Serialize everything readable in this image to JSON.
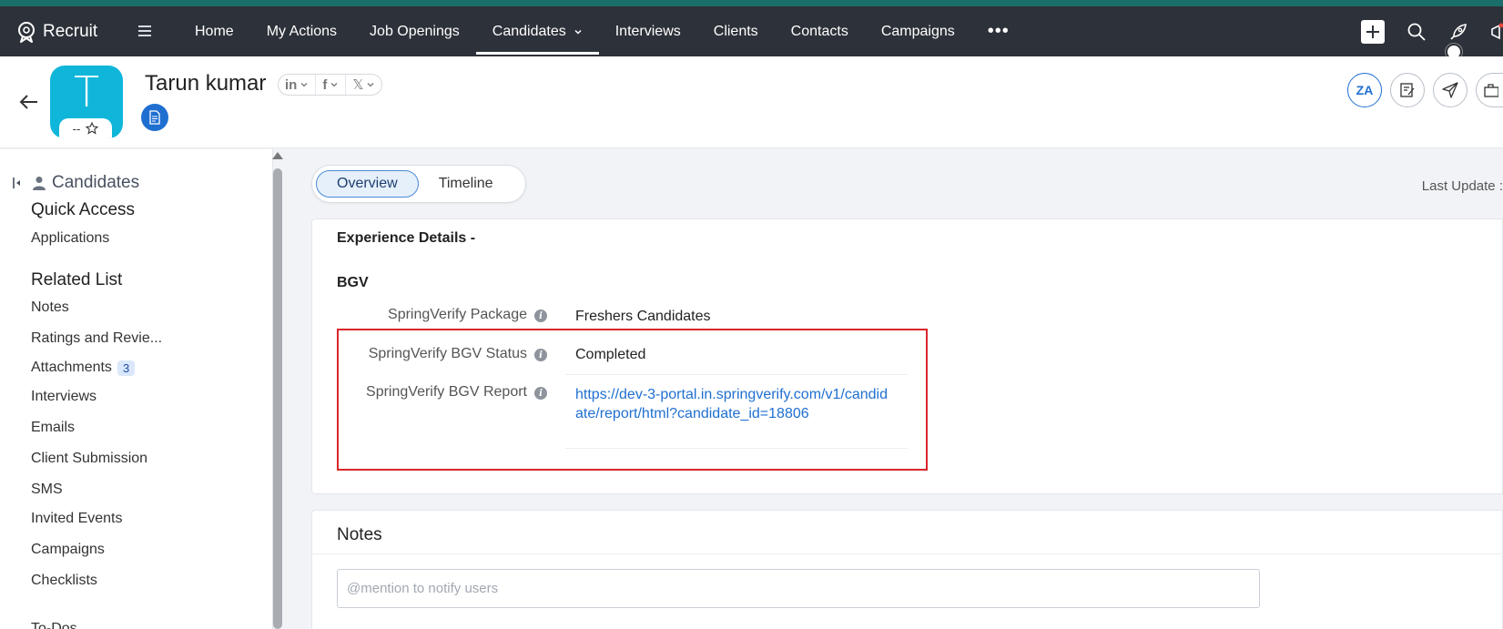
{
  "brand": {
    "name": "Recruit"
  },
  "nav": {
    "items": [
      {
        "label": "Home"
      },
      {
        "label": "My Actions"
      },
      {
        "label": "Job Openings"
      },
      {
        "label": "Candidates",
        "active": true
      },
      {
        "label": "Interviews"
      },
      {
        "label": "Clients"
      },
      {
        "label": "Contacts"
      },
      {
        "label": "Campaigns"
      }
    ],
    "more": "•••"
  },
  "record": {
    "avatar_letter": "T",
    "rating_text": "--",
    "name": "Tarun kumar",
    "social": {
      "linkedin": "in",
      "facebook": "f",
      "x": "𝕏"
    },
    "za_label": "ZA"
  },
  "sidebar": {
    "module_title": "Candidates",
    "quick_access_heading": "Quick Access",
    "quick_access": [
      "Applications"
    ],
    "related_list_heading": "Related List",
    "related": [
      {
        "label": "Notes"
      },
      {
        "label": "Ratings and Revie..."
      },
      {
        "label": "Attachments",
        "count": "3"
      },
      {
        "label": "Interviews"
      },
      {
        "label": "Emails"
      },
      {
        "label": "Client Submission"
      },
      {
        "label": "SMS"
      },
      {
        "label": "Invited Events"
      },
      {
        "label": "Campaigns"
      },
      {
        "label": "Checklists"
      },
      {
        "label": "To-Dos"
      }
    ]
  },
  "main": {
    "tabs": {
      "overview": "Overview",
      "timeline": "Timeline"
    },
    "last_update": "Last Update :",
    "experience_heading": "Experience Details -",
    "bgv_heading": "BGV",
    "fields": {
      "package_label": "SpringVerify Package",
      "package_value": "Freshers Candidates",
      "status_label": "SpringVerify BGV Status",
      "status_value": "Completed",
      "report_label": "SpringVerify BGV Report",
      "report_value": "https://dev-3-portal.in.springverify.com/v1/candidate/report/html?candidate_id=18806"
    },
    "notes": {
      "title": "Notes",
      "placeholder": "@mention to notify users"
    }
  },
  "colors": {
    "nav_bg": "#2d3139",
    "accent_strip": "#1a6e6a",
    "avatar_bg": "#0fb6d9",
    "link": "#1f6fd1",
    "highlight": "#d9262b"
  }
}
